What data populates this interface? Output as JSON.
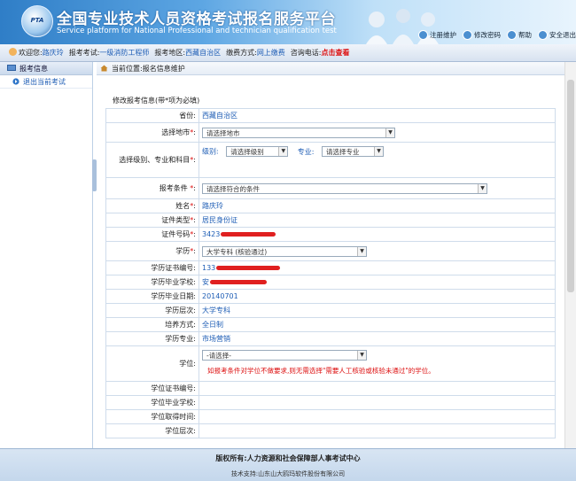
{
  "header": {
    "logo_text": "PTA",
    "title_cn": "全国专业技术人员资格考试报名服务平台",
    "title_en": "Service platform for National Professional and technician qualification test",
    "links": [
      "注册维护",
      "修改密码",
      "帮助",
      "安全退出"
    ]
  },
  "infobar": {
    "welcome_label": "欢迎您:",
    "user_name": "路庆玲",
    "exam_label": "报考考试:",
    "exam_value": "一级消防工程师",
    "region_label": "报考地区:",
    "region_value": "西藏自治区",
    "pay_label": "缴费方式:",
    "pay_value": "网上缴费",
    "phone_label": "咨询电话:",
    "phone_value": "点击查看"
  },
  "sidebar": {
    "header": "报考信息",
    "items": [
      "退出当前考试"
    ]
  },
  "breadcrumb": "当前位置:报名信息维护",
  "form": {
    "title": "修改报考信息(带*项为必填)",
    "province": {
      "label": "省份:",
      "value": "西藏自治区"
    },
    "city": {
      "label": "选择地市",
      "selected": "请选择地市"
    },
    "level": {
      "label": "选择级别、专业和科目",
      "level_label": "级别:",
      "level_selected": "请选择级别",
      "major_label": "专业:",
      "major_selected": "请选择专业"
    },
    "condition": {
      "label": "报考条件",
      "selected": "请选择符合的条件"
    },
    "name": {
      "label": "姓名",
      "value": "路庆玲"
    },
    "id_type": {
      "label": "证件类型",
      "value": "居民身份证"
    },
    "id_no": {
      "label": "证件号码",
      "value": "3423"
    },
    "education": {
      "label": "学历",
      "selected": "大学专科 (核验通过)"
    },
    "edu_cert": {
      "label": "学历证书编号:",
      "value": "133"
    },
    "edu_school": {
      "label": "学历毕业学校:",
      "value": "安"
    },
    "edu_date": {
      "label": "学历毕业日期:",
      "value": "20140701"
    },
    "edu_level": {
      "label": "学历层次:",
      "value": "大学专科"
    },
    "edu_mode": {
      "label": "培养方式:",
      "value": "全日制"
    },
    "edu_major": {
      "label": "学历专业:",
      "value": "市场营销"
    },
    "degree": {
      "label": "学位:",
      "selected": "-请选择-",
      "note": "如报考条件对学位不做要求,则无需选择\"需要人工核验或核验未通过\"的学位。"
    },
    "degree_cert": {
      "label": "学位证书编号:"
    },
    "degree_school": {
      "label": "学位毕业学校:"
    },
    "degree_date": {
      "label": "学位取得时间:"
    },
    "degree_level": {
      "label": "学位层次:"
    }
  },
  "footer": {
    "copyright": "版权所有:人力资源和社会保障部人事考试中心",
    "support": "技术支持:山东山大鸥玛软件股份有限公司"
  }
}
